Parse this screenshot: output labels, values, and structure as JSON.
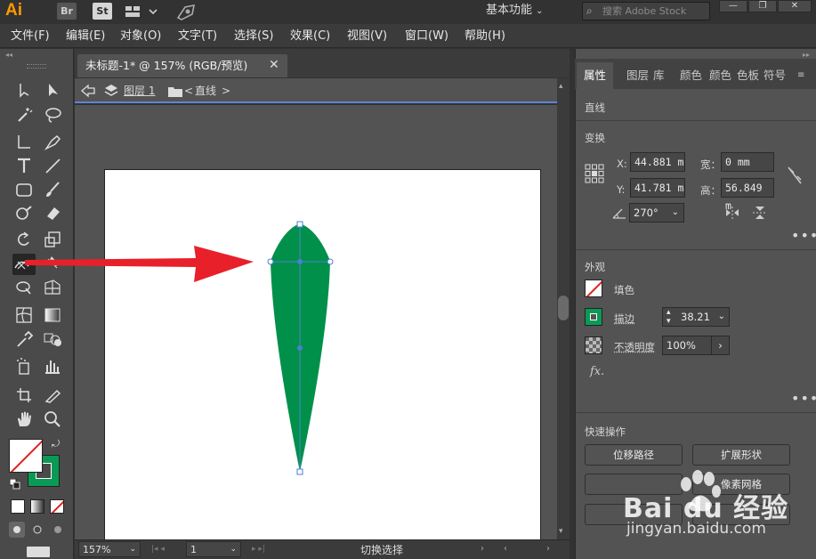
{
  "appbar": {
    "logo": "Ai",
    "br": "Br",
    "st": "St",
    "workspace": "基本功能",
    "stock_placeholder": "搜索 Adobe Stock",
    "win_min": "—",
    "win_max": "❐",
    "win_close": "✕"
  },
  "menubar": [
    "文件(F)",
    "编辑(E)",
    "对象(O)",
    "文字(T)",
    "选择(S)",
    "效果(C)",
    "视图(V)",
    "窗口(W)",
    "帮助(H)"
  ],
  "document": {
    "tab_title": "未标题-1* @ 157% (RGB/预览)",
    "tab_close": "✕",
    "breadcrumb_layer": "图层 1",
    "breadcrumb_object": "直线"
  },
  "statusbar": {
    "zoom": "157%",
    "artboard": "1",
    "tool_hint": "切换选择"
  },
  "panel": {
    "tabs": [
      "属性",
      "图层",
      "库",
      "颜色",
      "颜色",
      "色板",
      "符号"
    ],
    "selection_type": "直线",
    "transform": {
      "title": "变换",
      "x_label": "X:",
      "x_value": "44.881 m",
      "y_label": "Y:",
      "y_value": "41.781 m",
      "w_label": "宽：",
      "w_value": "0 mm",
      "h_label": "高：",
      "h_value": "56.849 m",
      "angle_value": "270°"
    },
    "appearance": {
      "title": "外观",
      "fill_label": "填色",
      "stroke_label": "描边",
      "stroke_value": "38.21",
      "opacity_label": "不透明度",
      "opacity_value": "100%",
      "fx_label": "fx."
    },
    "quick_actions": {
      "title": "快速操作",
      "offset_path": "位移路径",
      "expand_shape": "扩展形状",
      "pixel_grid": "像素网格"
    }
  },
  "colors": {
    "leaf_fill": "#00904a",
    "arrow_red": "#e8202a",
    "accent_blue": "#5c85d6",
    "selection_blue": "#4a7fd4"
  },
  "watermark": {
    "brand": "Bai du 经验",
    "url": "jingyan.baidu.com"
  }
}
